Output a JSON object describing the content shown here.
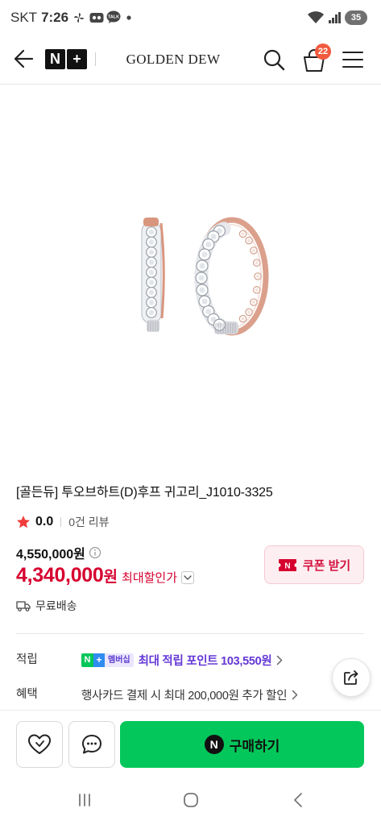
{
  "status_bar": {
    "carrier": "SKT",
    "time": "7:26",
    "talk_label": "TALK",
    "battery": "35"
  },
  "header": {
    "logo_n": "N",
    "logo_plus": "+",
    "brand": "GOLDEN DEW",
    "cart_count": "22"
  },
  "product": {
    "title": "[골든듀] 투오브하트(D)후프 귀고리_J1010-3325",
    "rating": "0.0",
    "review_count": "0건 리뷰",
    "original_price": "4,550,000원",
    "sale_price": "4,340,000",
    "sale_currency": "원",
    "sale_label": "최대할인가",
    "coupon": {
      "icon_letter": "N",
      "label": "쿠폰 받기"
    },
    "shipping": "무료배송"
  },
  "benefits": {
    "points": {
      "label": "적립",
      "badge_n": "N",
      "badge_plus": "+",
      "badge_text": "멤버십",
      "text": "최대 적립 포인트 103,550원"
    },
    "card": {
      "label": "혜택",
      "text": "행사카드 결제 시 최대 200,000원 추가 할인"
    }
  },
  "bottom_bar": {
    "buy_icon_letter": "N",
    "buy_label": "구매하기"
  },
  "icons": {
    "header": [
      "back-arrow-icon",
      "search-icon",
      "cart-icon",
      "menu-icon"
    ],
    "product": [
      "star-icon",
      "info-icon",
      "chevron-down-icon",
      "coupon-icon",
      "truck-icon"
    ],
    "benefits": [
      "chevron-right-icon",
      "share-icon"
    ],
    "bottom_bar": [
      "heart-icon",
      "chat-icon"
    ],
    "system_nav": [
      "recent-apps-icon",
      "home-icon",
      "back-icon"
    ]
  },
  "colors": {
    "brand_green": "#03c75a",
    "price_red": "#d6002f",
    "points_purple": "#6538d6",
    "cart_badge": "#f25a3f",
    "coupon_bg": "#fdeff1"
  }
}
